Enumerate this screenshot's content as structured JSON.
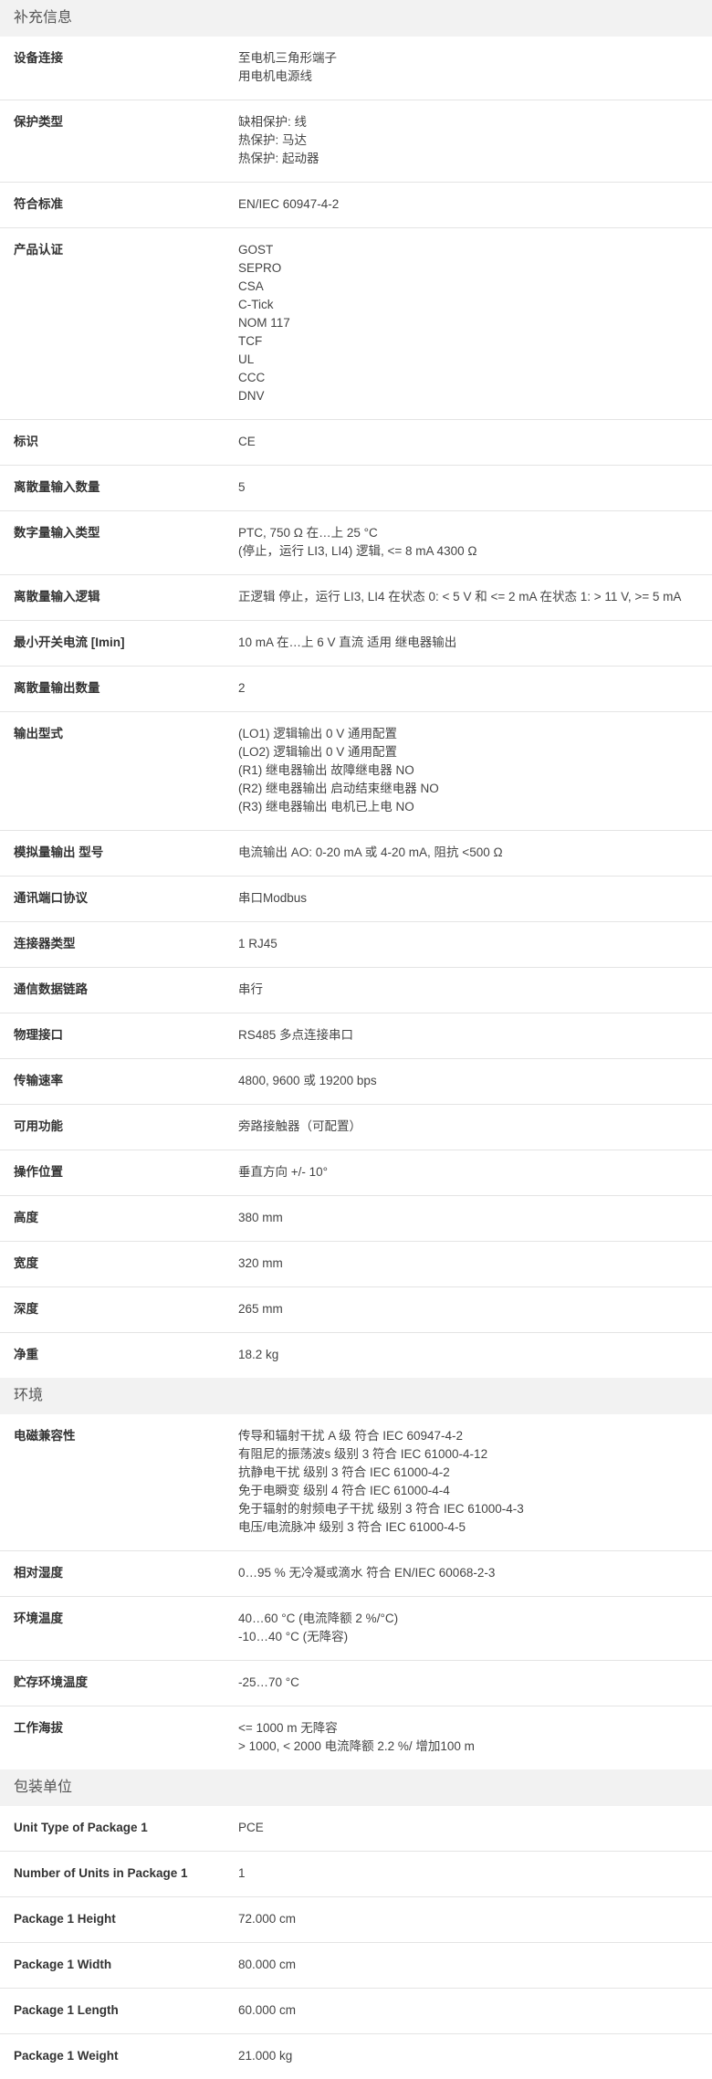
{
  "sections": [
    {
      "title": "补充信息",
      "rows": [
        {
          "label": "设备连接",
          "values": [
            "至电机三角形端子",
            "用电机电源线"
          ]
        },
        {
          "label": "保护类型",
          "values": [
            "缺相保护: 线",
            "热保护: 马达",
            "热保护: 起动器"
          ]
        },
        {
          "label": "符合标准",
          "values": [
            "EN/IEC 60947-4-2"
          ]
        },
        {
          "label": "产品认证",
          "values": [
            "GOST",
            "SEPRO",
            "CSA",
            "C-Tick",
            "NOM 117",
            "TCF",
            "UL",
            "CCC",
            "DNV"
          ]
        },
        {
          "label": "标识",
          "values": [
            "CE"
          ]
        },
        {
          "label": "离散量输入数量",
          "values": [
            "5"
          ]
        },
        {
          "label": "数字量输入类型",
          "values": [
            "PTC, 750 Ω 在…上 25 °C",
            "(停止，运行 LI3, LI4) 逻辑, <= 8 mA 4300 Ω"
          ]
        },
        {
          "label": "离散量输入逻辑",
          "values": [
            "正逻辑 停止，运行 LI3, LI4 在状态 0: < 5 V 和 <= 2 mA 在状态 1: > 11 V, >= 5 mA"
          ]
        },
        {
          "label": "最小开关电流 [Imin]",
          "values": [
            "10 mA 在…上 6 V 直流 适用 继电器输出"
          ]
        },
        {
          "label": "离散量输出数量",
          "values": [
            "2"
          ]
        },
        {
          "label": "输出型式",
          "values": [
            "(LO1) 逻辑输出 0 V 通用配置",
            "(LO2) 逻辑输出 0 V 通用配置",
            "(R1) 继电器输出 故障继电器 NO",
            "(R2) 继电器输出 启动结束继电器 NO",
            "(R3) 继电器输出 电机已上电 NO"
          ]
        },
        {
          "label": "模拟量输出 型号",
          "values": [
            "电流输出 AO: 0-20 mA 或 4-20 mA, 阻抗 <500 Ω"
          ]
        },
        {
          "label": "通讯端口协议",
          "values": [
            "串口Modbus"
          ]
        },
        {
          "label": "连接器类型",
          "values": [
            "1 RJ45"
          ]
        },
        {
          "label": "通信数据链路",
          "values": [
            "串行"
          ]
        },
        {
          "label": "物理接口",
          "values": [
            "RS485 多点连接串口"
          ]
        },
        {
          "label": "传输速率",
          "values": [
            "4800, 9600 或 19200 bps"
          ]
        },
        {
          "label": "可用功能",
          "values": [
            "旁路接触器（可配置）"
          ]
        },
        {
          "label": "操作位置",
          "values": [
            "垂直方向 +/- 10°"
          ]
        },
        {
          "label": "高度",
          "values": [
            "380 mm"
          ]
        },
        {
          "label": "宽度",
          "values": [
            "320 mm"
          ]
        },
        {
          "label": "深度",
          "values": [
            "265 mm"
          ]
        },
        {
          "label": "净重",
          "values": [
            "18.2 kg"
          ]
        }
      ]
    },
    {
      "title": "环境",
      "rows": [
        {
          "label": "电磁兼容性",
          "values": [
            "传导和辐射干扰 A 级 符合 IEC 60947-4-2",
            "有阻尼的振荡波s 级别 3 符合 IEC 61000-4-12",
            "抗静电干扰 级别 3 符合 IEC 61000-4-2",
            "免于电瞬变 级别 4 符合 IEC 61000-4-4",
            "免于辐射的射频电子干扰 级别 3 符合 IEC 61000-4-3",
            "电压/电流脉冲 级别 3 符合 IEC 61000-4-5"
          ]
        },
        {
          "label": "相对湿度",
          "values": [
            "0…95 % 无冷凝或滴水 符合 EN/IEC 60068-2-3"
          ]
        },
        {
          "label": "环境温度",
          "values": [
            "40…60 °C (电流降额 2 %/°C)",
            "-10…40 °C (无降容)"
          ]
        },
        {
          "label": "贮存环境温度",
          "values": [
            "-25…70 °C"
          ]
        },
        {
          "label": "工作海拔",
          "values": [
            "<= 1000 m 无降容",
            "> 1000, < 2000 电流降额 2.2 %/ 增加100 m"
          ]
        }
      ]
    },
    {
      "title": "包装单位",
      "rows": [
        {
          "label": "Unit Type of Package 1",
          "values": [
            "PCE"
          ]
        },
        {
          "label": "Number of Units in Package 1",
          "values": [
            "1"
          ]
        },
        {
          "label": "Package 1 Height",
          "values": [
            "72.000 cm"
          ]
        },
        {
          "label": "Package 1 Width",
          "values": [
            "80.000 cm"
          ]
        },
        {
          "label": "Package 1 Length",
          "values": [
            "60.000 cm"
          ]
        },
        {
          "label": "Package 1 Weight",
          "values": [
            "21.000 kg"
          ]
        }
      ]
    }
  ]
}
